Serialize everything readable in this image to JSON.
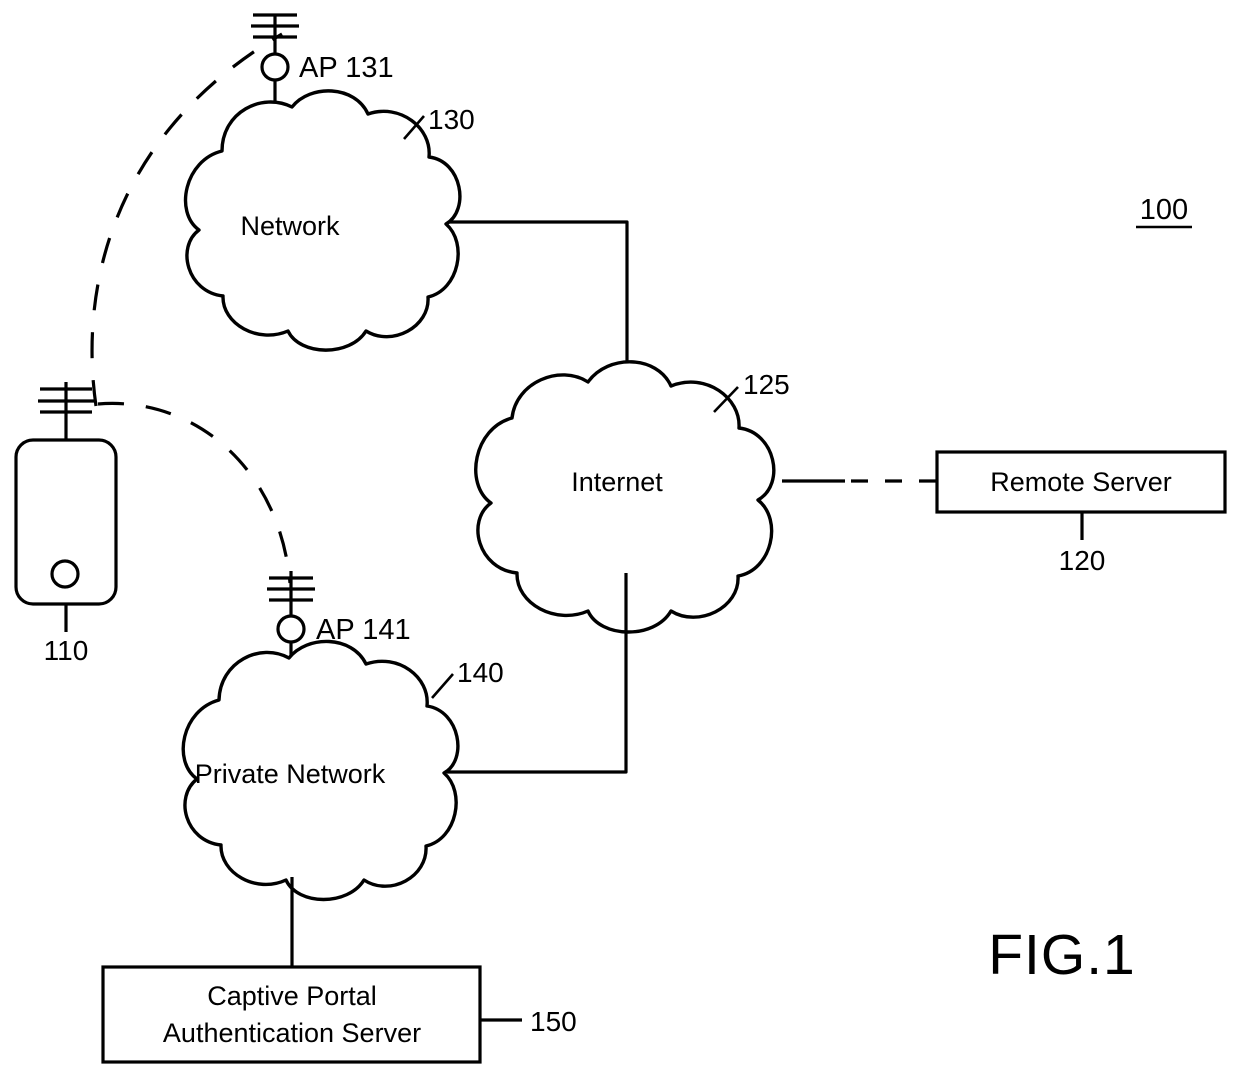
{
  "figure": {
    "id": "FIG.1",
    "system_ref": "100"
  },
  "nodes": {
    "mobile_device": {
      "name": "mobile-device",
      "ref": "110",
      "label": ""
    },
    "access_point_131": {
      "label": "AP 131"
    },
    "access_point_141": {
      "label": "AP 141"
    },
    "network": {
      "label": "Network",
      "ref": "130"
    },
    "internet": {
      "label": "Internet",
      "ref": "125"
    },
    "private_network": {
      "label": "Private Network",
      "ref": "140"
    },
    "remote_server": {
      "label": "Remote Server",
      "ref": "120"
    },
    "captive_portal": {
      "label_line1": "Captive Portal",
      "label_line2": "Authentication Server",
      "ref": "150"
    }
  },
  "colors": {
    "stroke": "#000000",
    "fill": "#ffffff"
  }
}
